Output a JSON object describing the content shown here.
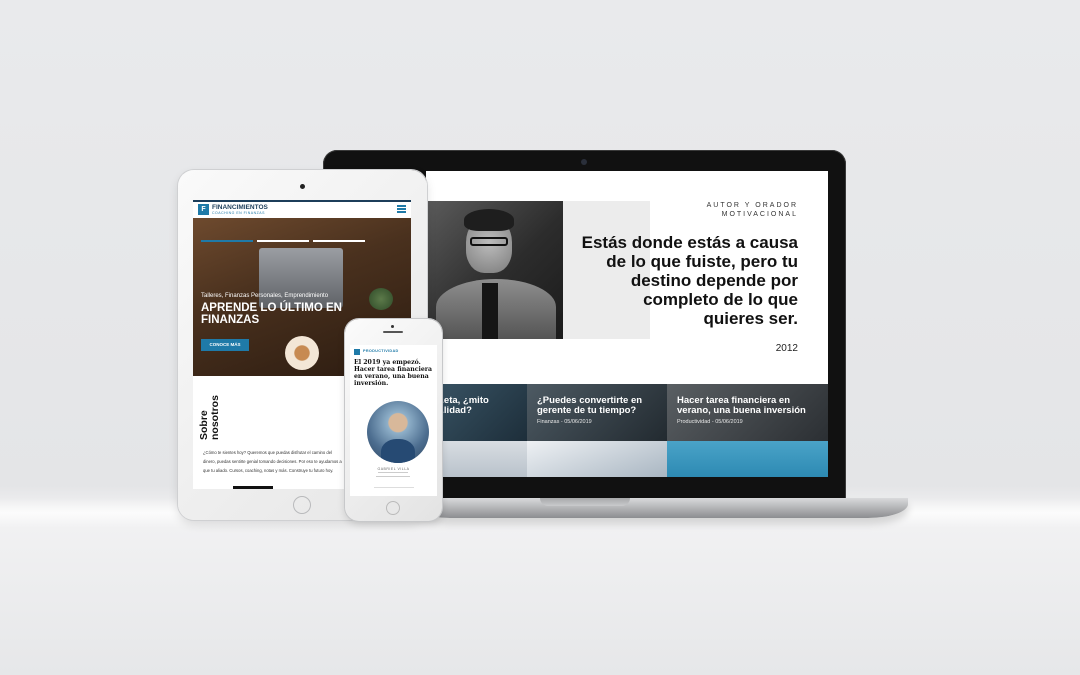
{
  "laptop": {
    "kicker": "AUTOR Y ORADOR MOTIVACIONAL",
    "quote": "Estás donde estás a causa de lo que fuiste, pero tu destino depende por completo de lo que quieres ser.",
    "year": "2012",
    "cards": [
      {
        "title": "...eta, ¿mito ...lidad?",
        "meta": ""
      },
      {
        "title": "¿Puedes convertirte en gerente de tu tiempo?",
        "meta": "Finanzas - 05/06/2019"
      },
      {
        "title": "Hacer tarea financiera en verano, una buena inversión",
        "meta": "Productividad - 05/06/2019"
      }
    ]
  },
  "tablet": {
    "brand": "FINANCIMIENTOS",
    "brand_sub": "COACHING EN FINANZAS",
    "logo_letter": "F",
    "hero_kicker": "Talleres, Finanzas Personales, Emprendimiento",
    "hero_title": "APRENDE LO ÚLTIMO EN FINANZAS",
    "cta": "CONOCE MÁS",
    "about_title_1": "Sobre",
    "about_title_2": "nosotros",
    "about_body": "¿Cómo te sientes hoy? Queremos que puedas disfrutar el camino del dinero, puedas sentirte genial tomando decisiones. Por eso te ayudamos a que tu aliado. Cursos, coaching, notas y más. Construye tu futuro hoy."
  },
  "phone": {
    "tag": "PRODUCTIVIDAD",
    "title": "El 2019 ya empezó. Hacer tarea financiera en verano, una buena inversión.",
    "author": "GABRIEL VILLA"
  },
  "colors": {
    "accent": "#1f7aa8",
    "navy": "#1c3d5a"
  }
}
